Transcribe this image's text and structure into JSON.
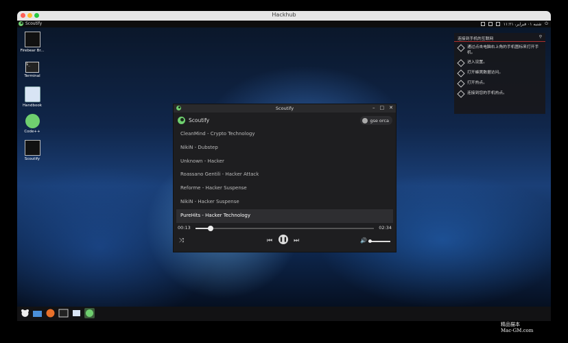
{
  "window": {
    "title": "Hackhub"
  },
  "topbar": {
    "app_name": "Scoutify",
    "clock": "شنبه ۰۱ فبرایر، ۱۱:۲۱"
  },
  "desktop_icons": [
    {
      "label": "Firebear Br..."
    },
    {
      "label": "Terminal"
    },
    {
      "label": "Handbook"
    },
    {
      "label": "Code++"
    },
    {
      "label": "Scoutify"
    }
  ],
  "notification": {
    "title": "连接到手机的互联网",
    "steps": [
      "通过点击电脑右上角的手机图标来打开手机。",
      "进入设置。",
      "打开蜂窝数据访问。",
      "打开热点。",
      "连接到您的手机热点。"
    ]
  },
  "player": {
    "window_title": "Scoutify",
    "brand": "Scoutify",
    "user": "gse orca",
    "tracks": [
      "CleanMind - Crypto Technology",
      "NikiN - Dubstep",
      "Unknown - Hacker",
      "Roassano Gentili - Hacker Attack",
      "Reforme - Hacker Suspense",
      "NikiN - Hacker Suspense",
      "PureHits - Hacker Technology"
    ],
    "active_index": 6,
    "elapsed": "00:13",
    "duration": "02:34",
    "progress": 0.085,
    "volume": 1.0
  },
  "watermark": {
    "line1": "精品猫本",
    "line2": "Mac-GM.com"
  },
  "colors": {
    "accent": "#6fcf6f",
    "notice_rule": "#b03030"
  }
}
